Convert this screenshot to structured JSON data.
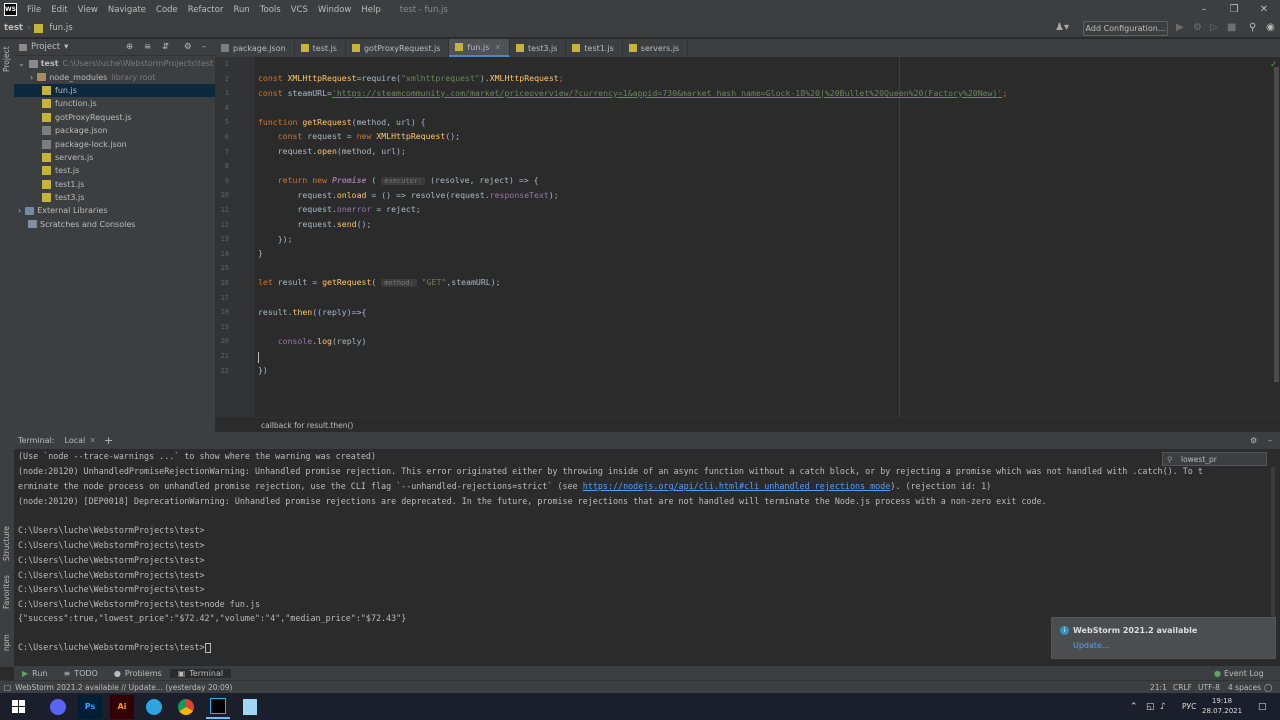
{
  "window": {
    "logo": "WS",
    "title": "test - fun.js",
    "menu": [
      "File",
      "Edit",
      "View",
      "Navigate",
      "Code",
      "Refactor",
      "Run",
      "Tools",
      "VCS",
      "Window",
      "Help"
    ]
  },
  "navbar": {
    "project_crumb": "test",
    "file_crumb": "fun.js",
    "add_configuration": "Add Configuration..."
  },
  "project_panel": {
    "title": "Project",
    "root_name": "test",
    "root_path": "C:\\Users\\luche\\WebstormProjects\\test",
    "node_modules": "node_modules",
    "node_modules_note": "library root",
    "files": [
      "fun.js",
      "function.js",
      "gotProxyRequest.js",
      "package.json",
      "package-lock.json",
      "servers.js",
      "test.js",
      "test1.js",
      "test3.js"
    ],
    "external_libraries": "External Libraries",
    "scratches": "Scratches and Consoles"
  },
  "side_strip": {
    "project": "Project",
    "structure": "Structure",
    "favorites": "Favorites",
    "npm": "npm"
  },
  "tabs": [
    {
      "label": "package.json",
      "type": "json"
    },
    {
      "label": "test.js",
      "type": "js"
    },
    {
      "label": "gotProxyRequest.js",
      "type": "js"
    },
    {
      "label": "fun.js",
      "type": "js",
      "active": true
    },
    {
      "label": "test3.js",
      "type": "js"
    },
    {
      "label": "test1.js",
      "type": "js"
    },
    {
      "label": "servers.js",
      "type": "js"
    }
  ],
  "editor": {
    "line_numbers": [
      "1",
      "2",
      "3",
      "4",
      "5",
      "6",
      "7",
      "8",
      "9",
      "10",
      "11",
      "12",
      "13",
      "14",
      "15",
      "16",
      "17",
      "18",
      "19",
      "20",
      "21",
      "22"
    ],
    "code": {
      "l2_a": "const ",
      "l2_b": "XMLHttpRequest",
      "l2_c": "=require(",
      "l2_d": "\"xmlhttprequest\"",
      "l2_e": ").",
      "l2_f": "XMLHttpRequest",
      "l2_g": ";",
      "l3_a": "const ",
      "l3_b": "steamURL=",
      "l3_c": "'https://steamcommunity.com/market/priceoverview/?currency=1&appid=730&market_hash_name=Glock-18%20|%20Bullet%20Queen%20(Factory%20New)'",
      "l3_d": ";",
      "l5_a": "function ",
      "l5_b": "getRequest",
      "l5_c": "(method, url) {",
      "l6_a": "    const ",
      "l6_b": "request = ",
      "l6_c": "new ",
      "l6_d": "XMLHttpRequest",
      "l6_e": "();",
      "l7_a": "    request.",
      "l7_b": "open",
      "l7_c": "(method, url);",
      "l9_a": "    return new ",
      "l9_b": "Promise",
      "l9_c": " ( ",
      "l9_hint": "executor:",
      "l9_d": " (resolve, reject) => {",
      "l10_a": "        request.",
      "l10_b": "onload",
      "l10_c": " = () => resolve(request.",
      "l10_d": "responseText",
      "l10_e": ");",
      "l11_a": "        request.",
      "l11_b": "onerror",
      "l11_c": " = reject;",
      "l12_a": "        request.",
      "l12_b": "send",
      "l12_c": "();",
      "l13": "    });",
      "l14": "}",
      "l16_a": "let ",
      "l16_b": "result = ",
      "l16_c": "getRequest",
      "l16_d": "( ",
      "l16_hint": "method:",
      "l16_e": " \"GET\"",
      "l16_f": ",steamURL);",
      "l18_a": "result.",
      "l18_b": "then",
      "l18_c": "((reply)=>{",
      "l20_a": "    ",
      "l20_b": "console",
      "l20_c": ".",
      "l20_d": "log",
      "l20_e": "(reply)",
      "l22": "})"
    },
    "breadcrumb": "callback for result.then()"
  },
  "terminal": {
    "title": "Terminal:",
    "tab": "Local",
    "search_value": "lowest_pr",
    "lines": {
      "t1": "(Use `node --trace-warnings ...` to show where the warning was created)",
      "t2": "(node:20120) UnhandledPromiseRejectionWarning: Unhandled promise rejection. This error originated either by throwing inside of an async function without a catch block, or by rejecting a promise which was not handled with .catch(). To t",
      "t3_a": "erminate the node process on unhandled promise rejection, use the CLI flag `--unhandled-rejections=strict` (see ",
      "t3_link": "https://nodejs.org/api/cli.html#cli_unhandled_rejections_mode",
      "t3_b": "). (rejection id: 1)",
      "t4": "(node:20120) [DEP0018] DeprecationWarning: Unhandled promise rejections are deprecated. In the future, promise rejections that are not handled will terminate the Node.js process with a non-zero exit code.",
      "p1": "C:\\Users\\luche\\WebstormProjects\\test>",
      "p2": "C:\\Users\\luche\\WebstormProjects\\test>",
      "p3": "C:\\Users\\luche\\WebstormProjects\\test>",
      "p4": "C:\\Users\\luche\\WebstormProjects\\test>",
      "p5": "C:\\Users\\luche\\WebstormProjects\\test>",
      "p6": "C:\\Users\\luche\\WebstormProjects\\test>node fun.js",
      "out": "{\"success\":true,\"lowest_price\":\"$72.42\",\"volume\":\"4\",\"median_price\":\"$72.43\"}",
      "p7": "C:\\Users\\luche\\WebstormProjects\\test>"
    }
  },
  "notification": {
    "title": "WebStorm 2021.2 available",
    "link": "Update..."
  },
  "bottom_tabs": [
    "Run",
    "TODO",
    "Problems",
    "Terminal"
  ],
  "event_log": "Event Log",
  "status": {
    "message": "WebStorm 2021.2 available // Update... (yesterday 20:09)",
    "position": "21:1",
    "line_sep": "CRLF",
    "encoding": "UTF-8",
    "indent": "4 spaces"
  },
  "taskbar": {
    "lang": "РУС",
    "time": "19:18",
    "date": "28.07.2021"
  }
}
